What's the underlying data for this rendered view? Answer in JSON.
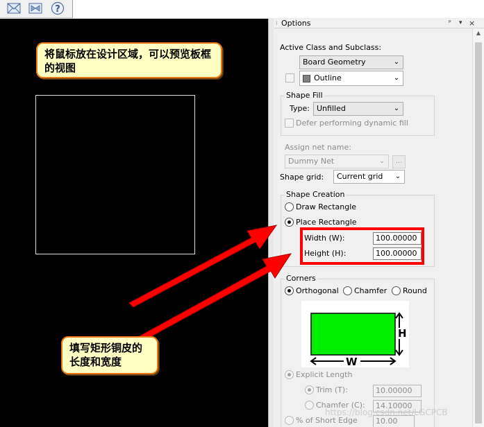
{
  "toolbar": {
    "icons": [
      "envelope-icon",
      "bowtie-icon",
      "help-icon"
    ]
  },
  "canvas": {
    "background": "#000000",
    "outline_color": "#e0e0e0"
  },
  "callouts": {
    "hover_preview": "将鼠标放在设计区域，可以预览板框的视图",
    "fill_size": "填写矩形铜皮的长度和宽度"
  },
  "options_panel": {
    "title": "Options",
    "pin_glyph": "ᵖ",
    "menu_glyph": "▾",
    "close_glyph": "×",
    "active_class_label": "Active Class and Subclass:",
    "class_value": "Board Geometry",
    "subclass_value": "Outline",
    "shape_fill": {
      "title": "Shape Fill",
      "type_label": "Type:",
      "type_value": "Unfilled",
      "defer_label": "Defer performing dynamic fill"
    },
    "assign_net_label": "Assign net name:",
    "net_value": "Dummy Net",
    "net_browse_label": "...",
    "shape_grid_label": "Shape grid:",
    "shape_grid_value": "Current grid",
    "shape_creation": {
      "title": "Shape Creation",
      "draw_rectangle": "Draw Rectangle",
      "place_rectangle": "Place Rectangle",
      "selected": "Place Rectangle",
      "width_label": "Width (W):",
      "width_value": "100.00000",
      "height_label": "Height (H):",
      "height_value": "100.00000"
    },
    "corners": {
      "title": "Corners",
      "orthogonal": "Orthogonal",
      "chamfer": "Chamfer",
      "round": "Round",
      "selected": "Orthogonal",
      "diagram_h": "H",
      "diagram_w": "W",
      "diagram_fill": "#00ee00",
      "explicit_length": "Explicit Length",
      "trim_label": "Trim (T):",
      "trim_value": "10.00000",
      "chamfer_label": "Chamfer (C):",
      "chamfer_value": "14.10000",
      "short_edge_label": "% of Short Edge",
      "short_edge_value": "10.00"
    }
  },
  "watermark": "https://blog.csdn.net/LGCPCB",
  "colors": {
    "annotation_red": "#ff0000",
    "callout_fill": "#ffffc4",
    "callout_border": "#e87811"
  }
}
